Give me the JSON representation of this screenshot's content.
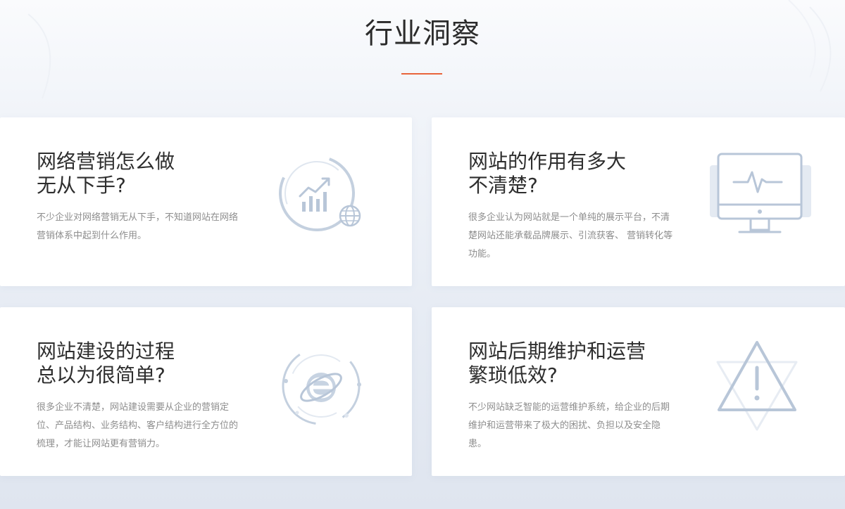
{
  "section": {
    "title": "行业洞察"
  },
  "cards": [
    {
      "title_lines": [
        "网络营销怎么做",
        "无从下手?"
      ],
      "description": "不少企业对网络营销无从下手，不知道网站在网络营销体系中起到什么作用。",
      "icon": "growth-chart-globe-icon"
    },
    {
      "title_lines": [
        "网站的作用有多大",
        "不清楚?"
      ],
      "description": "很多企业认为网站就是一个单纯的展示平台，不清楚网站还能承载品牌展示、引流获客、 营销转化等功能。",
      "icon": "monitor-pulse-icon"
    },
    {
      "title_lines": [
        "网站建设的过程",
        "总以为很简单?"
      ],
      "description": "很多企业不清楚，网站建设需要从企业的营销定位、产品结构、业务结构、客户结构进行全方位的梳理，才能让网站更有营销力。",
      "icon": "browser-e-icon"
    },
    {
      "title_lines": [
        "网站后期维护和运营",
        "繁琐低效?"
      ],
      "description": "不少网站缺乏智能的运营维护系统，给企业的后期维护和运营带来了极大的困扰、负担以及安全隐患。",
      "icon": "warning-triangle-icon"
    }
  ],
  "colors": {
    "accent": "#e8643a",
    "icon": "#b8c6d8",
    "title": "#2e2e2e",
    "description": "#8d8d8d",
    "card": "#ffffff"
  }
}
